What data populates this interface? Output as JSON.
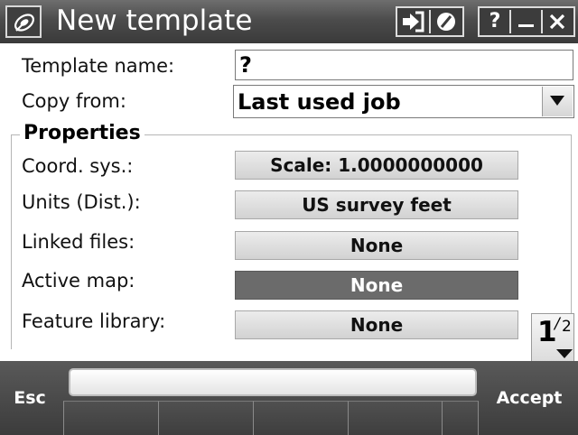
{
  "window": {
    "title": "New template",
    "buttons": {
      "login_icon": "login-arrow-icon",
      "no_icon": "circle-slash-icon",
      "help_label": "?",
      "minimize_icon": "minimize-icon",
      "close_icon": "close-icon"
    }
  },
  "form": {
    "template_name": {
      "label": "Template name:",
      "value": "?"
    },
    "copy_from": {
      "label": "Copy from:",
      "value": "Last used job"
    }
  },
  "properties": {
    "title": "Properties",
    "rows": [
      {
        "label": "Coord. sys.:",
        "value": "Scale:  1.0000000000",
        "active": false
      },
      {
        "label": "Units (Dist.):",
        "value": "US survey feet",
        "active": false
      },
      {
        "label": "Linked files:",
        "value": "None",
        "active": false
      },
      {
        "label": "Active map:",
        "value": "None",
        "active": true
      },
      {
        "label": "Feature library:",
        "value": "None",
        "active": false
      }
    ]
  },
  "pager": {
    "current": "1",
    "separator": "/",
    "total": "2"
  },
  "softkeys": {
    "left": "Esc",
    "right": "Accept",
    "status_text": ""
  },
  "colors": {
    "titlebar": "#4c4c4c",
    "softbar": "#4a4a4a",
    "active_button": "#6b6b6b",
    "button": "#dedede"
  }
}
